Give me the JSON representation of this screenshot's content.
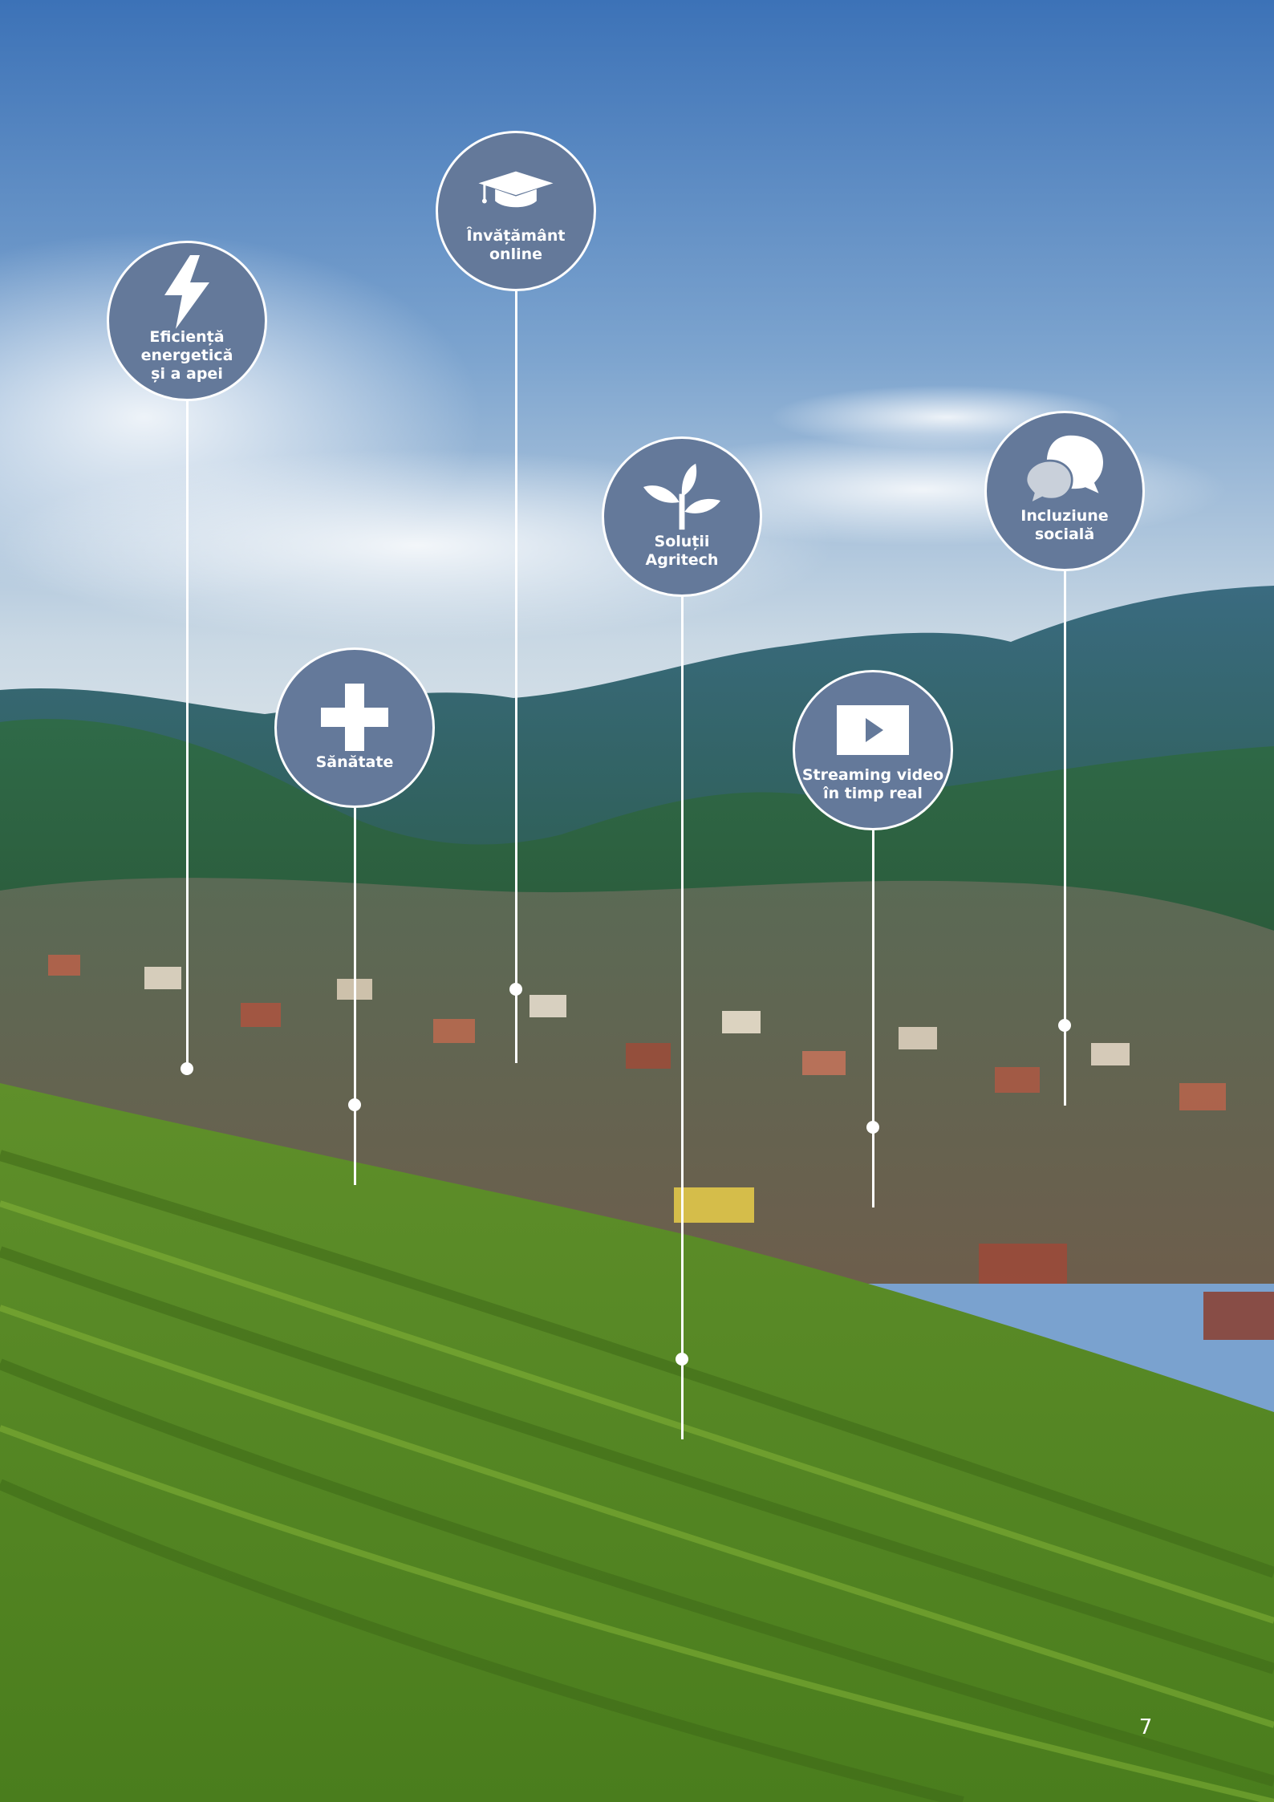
{
  "callouts": [
    {
      "name": "energy-efficiency",
      "icon": "lightning-bolt-icon",
      "label": "Eficiență\nenergetică\nși a apei"
    },
    {
      "name": "online-learning",
      "icon": "graduation-cap-icon",
      "label": "Învățământ\nonline"
    },
    {
      "name": "health",
      "icon": "medical-cross-icon",
      "label": "Sănătate"
    },
    {
      "name": "agritech",
      "icon": "plant-sprout-icon",
      "label": "Soluții\nAgritech"
    },
    {
      "name": "video-streaming",
      "icon": "play-button-icon",
      "label": "Streaming video\nîn timp real"
    },
    {
      "name": "social-inclusion",
      "icon": "speech-bubbles-icon",
      "label": "Incluziune\nsocială"
    }
  ],
  "page_number": "7",
  "colors": {
    "bubble": "#64799a",
    "outline": "#ffffff",
    "sky": "#3f76b8",
    "mountains": "#2f5d52",
    "vineyard": "#6f9a2c"
  }
}
